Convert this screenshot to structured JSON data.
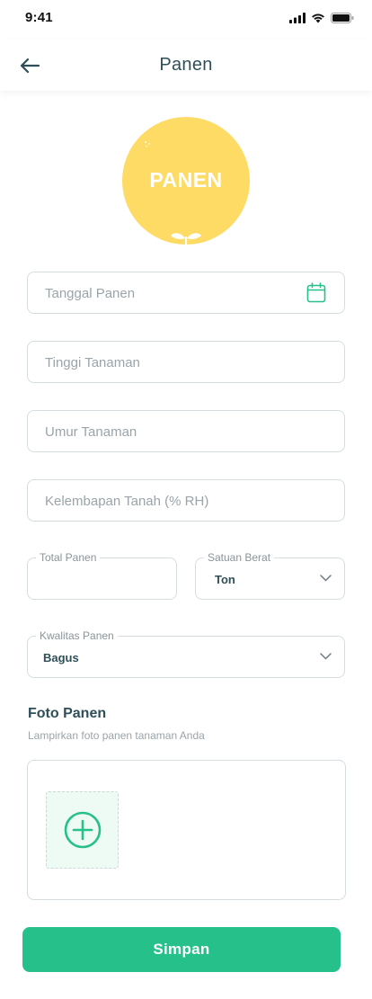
{
  "status_bar": {
    "time": "9:41"
  },
  "header": {
    "title": "Panen"
  },
  "badge": {
    "label": "PANEN"
  },
  "form": {
    "harvest_date": {
      "placeholder": "Tanggal Panen"
    },
    "plant_height": {
      "placeholder": "Tinggi Tanaman"
    },
    "plant_age": {
      "placeholder": "Umur Tanaman"
    },
    "soil_moisture": {
      "placeholder": "Kelembapan Tanah (% RH)"
    },
    "total_harvest": {
      "label": "Total Panen",
      "value": ""
    },
    "weight_unit": {
      "label": "Satuan Berat",
      "value": "Ton"
    },
    "harvest_quality": {
      "label": "Kwalitas Panen",
      "value": "Bagus"
    }
  },
  "photo_section": {
    "title": "Foto Panen",
    "subtitle": "Lampirkan foto panen tanaman Anda"
  },
  "actions": {
    "save_label": "Simpan"
  },
  "colors": {
    "accent": "#26c08a",
    "badge": "#fedb64",
    "text_primary": "#2f4f58",
    "placeholder": "#9aa4a9",
    "border": "#d6dde1"
  },
  "icons": [
    "signal-icon",
    "wifi-icon",
    "battery-icon",
    "back-arrow-icon",
    "calendar-icon",
    "chevron-down-icon",
    "add-photo-icon",
    "sprout-icon",
    "sparkle-icon"
  ]
}
